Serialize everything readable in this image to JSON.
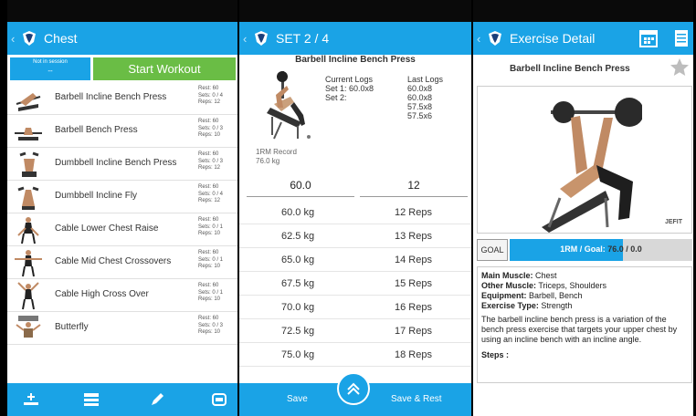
{
  "colors": {
    "accent": "#1aa3e6",
    "start_green": "#6abd45"
  },
  "panel1": {
    "title": "Chest",
    "not_in_session": "Not in session",
    "session_dash": "--",
    "start_workout": "Start Workout",
    "exercises": [
      {
        "name": "Barbell Incline Bench Press",
        "rest": "Rest: 60",
        "sets": "Sets: 0 / 4",
        "reps": "Reps: 12"
      },
      {
        "name": "Barbell Bench Press",
        "rest": "Rest: 60",
        "sets": "Sets: 0 / 3",
        "reps": "Reps: 10"
      },
      {
        "name": "Dumbbell Incline Bench Press",
        "rest": "Rest: 60",
        "sets": "Sets: 0 / 3",
        "reps": "Reps: 12"
      },
      {
        "name": "Dumbbell Incline Fly",
        "rest": "Rest: 60",
        "sets": "Sets: 0 / 4",
        "reps": "Reps: 12"
      },
      {
        "name": "Cable Lower Chest Raise",
        "rest": "Rest: 60",
        "sets": "Sets: 0 / 1",
        "reps": "Reps: 10"
      },
      {
        "name": "Cable Mid Chest Crossovers",
        "rest": "Rest: 60",
        "sets": "Sets: 0 / 1",
        "reps": "Reps: 10"
      },
      {
        "name": "Cable High Cross Over",
        "rest": "Rest: 60",
        "sets": "Sets: 0 / 1",
        "reps": "Reps: 10"
      },
      {
        "name": "Butterfly",
        "rest": "Rest: 60",
        "sets": "Sets: 0 / 3",
        "reps": "Reps: 10"
      }
    ],
    "bottom_icons": [
      "add-exercise-icon",
      "reorder-icon",
      "edit-pencil-icon",
      "superset-icon"
    ]
  },
  "panel2": {
    "title": "SET 2 / 4",
    "exercise": "Barbell Incline Bench Press",
    "current_logs_label": "Current Logs",
    "last_logs_label": "Last Logs",
    "current_logs": [
      "Set 1: 60.0x8",
      "Set 2:"
    ],
    "last_logs": [
      "60.0x8",
      "60.0x8",
      "57.5x8",
      "57.5x6"
    ],
    "record_label": "1RM Record",
    "record_value": "76.0 kg",
    "weight_input": "60.0",
    "reps_input": "12",
    "options": [
      {
        "weight": "60.0 kg",
        "reps": "12 Reps"
      },
      {
        "weight": "62.5 kg",
        "reps": "13 Reps"
      },
      {
        "weight": "65.0 kg",
        "reps": "14 Reps"
      },
      {
        "weight": "67.5 kg",
        "reps": "15 Reps"
      },
      {
        "weight": "70.0 kg",
        "reps": "16 Reps"
      },
      {
        "weight": "72.5 kg",
        "reps": "17 Reps"
      },
      {
        "weight": "75.0 kg",
        "reps": "18 Reps"
      }
    ],
    "save": "Save",
    "save_rest": "Save & Rest"
  },
  "panel3": {
    "title": "Exercise Detail",
    "exercise": "Barbell Incline Bench Press",
    "brand": "JEFIT",
    "goal_button": "GOAL",
    "goal_label": "1RM / Goal:",
    "goal_value": "76.0 / 0.0",
    "goal_fill_fraction": 0.62,
    "main_muscle_label": "Main Muscle:",
    "main_muscle": "Chest",
    "other_muscle_label": "Other Muscle:",
    "other_muscle": "Triceps, Shoulders",
    "equipment_label": "Equipment:",
    "equipment": "Barbell, Bench",
    "exercise_type_label": "Exercise Type:",
    "exercise_type": "Strength",
    "description": "The barbell incline bench press is a variation of the bench press exercise that targets your upper chest by using an incline bench with an incline angle.",
    "steps_label": "Steps :"
  }
}
